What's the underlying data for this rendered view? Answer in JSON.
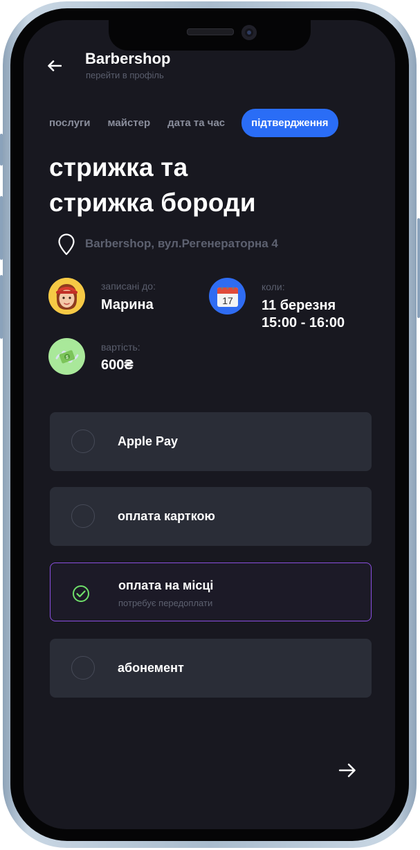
{
  "header": {
    "title": "Barbershop",
    "subtitle": "перейти в профіль"
  },
  "steps": [
    {
      "label": "послуги",
      "active": false
    },
    {
      "label": "майстер",
      "active": false
    },
    {
      "label": "дата та час",
      "active": false
    },
    {
      "label": "підтвердження",
      "active": true
    }
  ],
  "service": {
    "title_line1": "стрижка та",
    "title_line2": "стрижка бороди",
    "address": "Barbershop, вул.Регенераторна 4"
  },
  "details": {
    "master": {
      "label": "записані до:",
      "value": "Марина",
      "icon": "woman-avatar-emoji"
    },
    "when": {
      "label": "коли:",
      "date": "11 березня",
      "time": "15:00 - 16:00",
      "icon": "calendar-emoji",
      "calendar_day": "17"
    },
    "price": {
      "label": "вартість:",
      "value": "600₴",
      "icon": "money-with-wings-emoji"
    }
  },
  "payment_options": [
    {
      "label": "Apple Pay",
      "sub": "",
      "selected": false
    },
    {
      "label": "оплата карткою",
      "sub": "",
      "selected": false
    },
    {
      "label": "оплата на місці",
      "sub": "потребує передоплати",
      "selected": true
    },
    {
      "label": "абонемент",
      "sub": "",
      "selected": false
    }
  ],
  "colors": {
    "background": "#181820",
    "accent": "#2a6df6",
    "selected_border": "#8a4fe0",
    "check": "#6fe06a",
    "option_bg": "#2a2d37"
  }
}
